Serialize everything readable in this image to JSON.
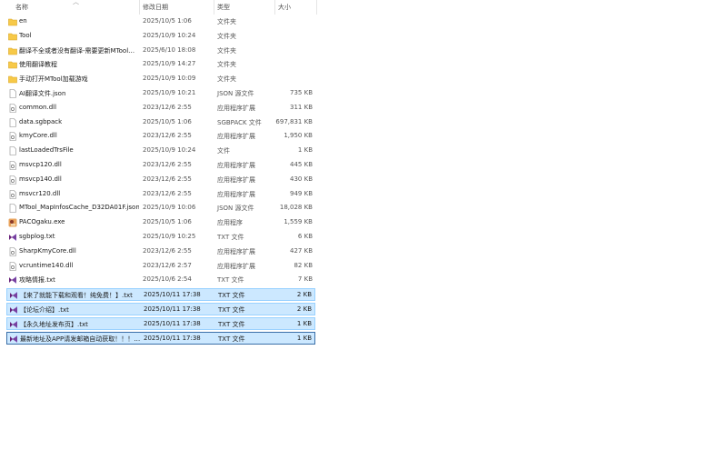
{
  "columns": {
    "name": "名称",
    "date": "修改日期",
    "type": "类型",
    "size": "大小"
  },
  "files": [
    {
      "name": "en",
      "date": "2025/10/5 1:06",
      "type": "文件夹",
      "size": "",
      "icon": "folder-icon"
    },
    {
      "name": "Tool",
      "date": "2025/10/9 10:24",
      "type": "文件夹",
      "size": "",
      "icon": "folder-icon"
    },
    {
      "name": "翻译不全或者没有翻译-需要更新MTool…",
      "date": "2025/6/10 18:08",
      "type": "文件夹",
      "size": "",
      "icon": "folder-icon"
    },
    {
      "name": "使用翻译教程",
      "date": "2025/10/9 14:27",
      "type": "文件夹",
      "size": "",
      "icon": "folder-icon"
    },
    {
      "name": "手动打开MTool加载游戏",
      "date": "2025/10/9 10:09",
      "type": "文件夹",
      "size": "",
      "icon": "folder-icon"
    },
    {
      "name": "AI翻译文件.json",
      "date": "2025/10/9 10:21",
      "type": "JSON 源文件",
      "size": "735 KB",
      "icon": "file-icon"
    },
    {
      "name": "common.dll",
      "date": "2023/12/6 2:55",
      "type": "应用程序扩展",
      "size": "311 KB",
      "icon": "dll-icon"
    },
    {
      "name": "data.sgbpack",
      "date": "2025/10/5 1:06",
      "type": "SGBPACK 文件",
      "size": "697,831 KB",
      "icon": "file-icon"
    },
    {
      "name": "kmyCore.dll",
      "date": "2023/12/6 2:55",
      "type": "应用程序扩展",
      "size": "1,950 KB",
      "icon": "dll-icon"
    },
    {
      "name": "lastLoadedTrsFile",
      "date": "2025/10/9 10:24",
      "type": "文件",
      "size": "1 KB",
      "icon": "file-icon"
    },
    {
      "name": "msvcp120.dll",
      "date": "2023/12/6 2:55",
      "type": "应用程序扩展",
      "size": "445 KB",
      "icon": "dll-icon"
    },
    {
      "name": "msvcp140.dll",
      "date": "2023/12/6 2:55",
      "type": "应用程序扩展",
      "size": "430 KB",
      "icon": "dll-icon"
    },
    {
      "name": "msvcr120.dll",
      "date": "2023/12/6 2:55",
      "type": "应用程序扩展",
      "size": "949 KB",
      "icon": "dll-icon"
    },
    {
      "name": "MTool_MapInfosCache_D32DA01F.json",
      "date": "2025/10/9 10:06",
      "type": "JSON 源文件",
      "size": "18,028 KB",
      "icon": "file-icon"
    },
    {
      "name": "PACOgaku.exe",
      "date": "2025/10/5 1:06",
      "type": "应用程序",
      "size": "1,559 KB",
      "icon": "exe-icon"
    },
    {
      "name": "sgbplog.txt",
      "date": "2025/10/9 10:25",
      "type": "TXT 文件",
      "size": "6 KB",
      "icon": "txt-icon"
    },
    {
      "name": "SharpKmyCore.dll",
      "date": "2023/12/6 2:55",
      "type": "应用程序扩展",
      "size": "427 KB",
      "icon": "dll-icon"
    },
    {
      "name": "vcruntime140.dll",
      "date": "2023/12/6 2:57",
      "type": "应用程序扩展",
      "size": "82 KB",
      "icon": "dll-icon"
    },
    {
      "name": "攻略情报.txt",
      "date": "2025/10/6 2:54",
      "type": "TXT 文件",
      "size": "7 KB",
      "icon": "txt-icon"
    },
    {
      "name": "【来了就能下载和观看！纯免费！】.txt",
      "date": "2025/10/11 17:38",
      "type": "TXT 文件",
      "size": "2 KB",
      "icon": "txt-icon",
      "selected": true
    },
    {
      "name": "【论坛介绍】.txt",
      "date": "2025/10/11 17:38",
      "type": "TXT 文件",
      "size": "2 KB",
      "icon": "txt-icon",
      "selected": true
    },
    {
      "name": "【永久地址发布页】.txt",
      "date": "2025/10/11 17:38",
      "type": "TXT 文件",
      "size": "1 KB",
      "icon": "txt-icon",
      "selected": true
    },
    {
      "name": "最新地址及APP请发邮箱自动获取！！！…",
      "date": "2025/10/11 17:38",
      "type": "TXT 文件",
      "size": "1 KB",
      "icon": "txt-icon",
      "selected": true,
      "focused": true
    }
  ]
}
